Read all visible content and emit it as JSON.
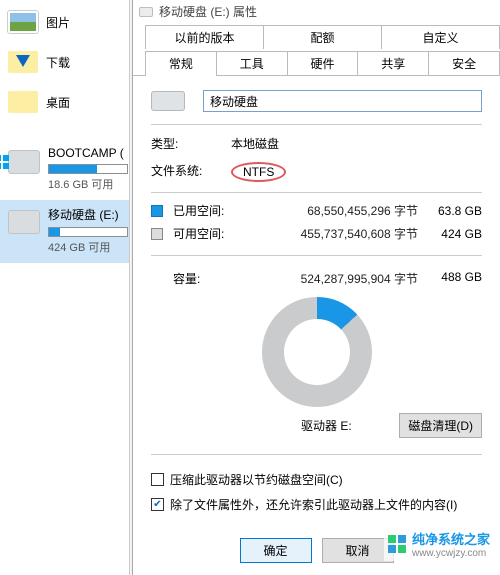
{
  "explorer": {
    "quick": [
      {
        "label": "图片"
      },
      {
        "label": "下载"
      },
      {
        "label": "桌面"
      }
    ],
    "drives": [
      {
        "title": "BOOTCAMP (",
        "usage_text": "18.6 GB 可用",
        "fill_css": "width:62%"
      },
      {
        "title": "移动硬盘 (E:)",
        "usage_text": "424 GB 可用",
        "fill_css": "width:14%"
      }
    ]
  },
  "props": {
    "window_title": "移动硬盘 (E:) 属性",
    "tabs_row1": [
      "以前的版本",
      "配额",
      "自定义"
    ],
    "tabs_row2": [
      "常规",
      "工具",
      "硬件",
      "共享",
      "安全"
    ],
    "selected_tab": "常规",
    "name_value": "移动硬盘",
    "kv": {
      "type_label": "类型:",
      "type_value": "本地磁盘",
      "fs_label": "文件系统:",
      "fs_value": "NTFS"
    },
    "usage": {
      "used_label": "已用空间:",
      "used_bytes": "68,550,455,296 字节",
      "used_size": "63.8 GB",
      "free_label": "可用空间:",
      "free_bytes": "455,737,540,608 字节",
      "free_size": "424 GB",
      "total_label": "容量:",
      "total_bytes": "524,287,995,904 字节",
      "total_size": "488 GB"
    },
    "drive_label": "驱动器 E:",
    "disk_cleanup": "磁盘清理(D)",
    "check_compress": "压缩此驱动器以节约磁盘空间(C)",
    "check_index": "除了文件属性外，还允许索引此驱动器上文件的内容(I)",
    "buttons": {
      "ok": "确定",
      "cancel": "取消"
    }
  },
  "watermark": {
    "text": "纯净系统之家",
    "url": "www.ycwjzy.com"
  },
  "chart_data": {
    "type": "pie",
    "title": "驱动器 E: 空间使用 (donut)",
    "series": [
      {
        "name": "已用空间",
        "value": 68550455296,
        "display": "63.8 GB",
        "color": "#1996e6"
      },
      {
        "name": "可用空间",
        "value": 455737540608,
        "display": "424 GB",
        "color": "#c9cbcd"
      }
    ],
    "total": {
      "value": 524287995904,
      "display": "488 GB"
    }
  }
}
